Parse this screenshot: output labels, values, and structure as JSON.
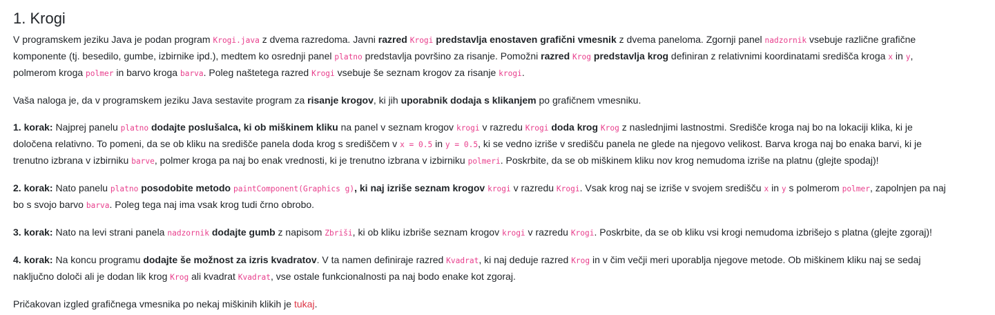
{
  "title": "1. Krogi",
  "paragraphs": [
    {
      "lines": [
        [
          {
            "t": "text",
            "v": "V programskem jeziku Java je podan program "
          },
          {
            "t": "code",
            "v": "Krogi.java"
          },
          {
            "t": "text",
            "v": " z dvema razredoma. Javni "
          },
          {
            "t": "bold",
            "v": "razred"
          },
          {
            "t": "text",
            "v": " "
          },
          {
            "t": "code",
            "v": "Krogi"
          },
          {
            "t": "text",
            "v": " "
          },
          {
            "t": "bold",
            "v": "predstavlja enostaven grafični vmesnik"
          },
          {
            "t": "text",
            "v": " z dvema paneloma. Zgornji panel "
          },
          {
            "t": "code",
            "v": "nadzornik"
          },
          {
            "t": "text",
            "v": " vsebuje različne grafične"
          }
        ],
        [
          {
            "t": "text",
            "v": "komponente (tj. besedilo, gumbe, izbirnike ipd.), medtem ko osrednji panel "
          },
          {
            "t": "code",
            "v": "platno"
          },
          {
            "t": "text",
            "v": " predstavlja površino za risanje. Pomožni "
          },
          {
            "t": "bold",
            "v": "razred"
          },
          {
            "t": "text",
            "v": " "
          },
          {
            "t": "code",
            "v": "Krog"
          },
          {
            "t": "text",
            "v": " "
          },
          {
            "t": "bold",
            "v": "predstavlja krog"
          },
          {
            "t": "text",
            "v": " definiran z relativnimi koordinatami središča kroga "
          },
          {
            "t": "code",
            "v": "x"
          },
          {
            "t": "text",
            "v": " in "
          },
          {
            "t": "code",
            "v": "y"
          },
          {
            "t": "text",
            "v": ","
          }
        ],
        [
          {
            "t": "text",
            "v": "polmerom kroga "
          },
          {
            "t": "code",
            "v": "polmer"
          },
          {
            "t": "text",
            "v": " in barvo kroga "
          },
          {
            "t": "code",
            "v": "barva"
          },
          {
            "t": "text",
            "v": ". Poleg naštetega razred "
          },
          {
            "t": "code",
            "v": "Krogi"
          },
          {
            "t": "text",
            "v": " vsebuje še seznam krogov za risanje "
          },
          {
            "t": "code",
            "v": "krogi"
          },
          {
            "t": "text",
            "v": "."
          }
        ]
      ]
    },
    {
      "lines": [
        [
          {
            "t": "text",
            "v": "Vaša naloga je, da v programskem jeziku Java sestavite program za "
          },
          {
            "t": "bold",
            "v": "risanje krogov"
          },
          {
            "t": "text",
            "v": ", ki jih "
          },
          {
            "t": "bold",
            "v": "uporabnik dodaja s klikanjem"
          },
          {
            "t": "text",
            "v": " po grafičnem vmesniku."
          }
        ]
      ]
    },
    {
      "lines": [
        [
          {
            "t": "bold",
            "v": "1. korak:"
          },
          {
            "t": "text",
            "v": " Najprej panelu "
          },
          {
            "t": "code",
            "v": "platno"
          },
          {
            "t": "text",
            "v": " "
          },
          {
            "t": "bold",
            "v": "dodajte poslušalca, ki ob miškinem kliku"
          },
          {
            "t": "text",
            "v": " na panel v seznam krogov "
          },
          {
            "t": "code",
            "v": "krogi"
          },
          {
            "t": "text",
            "v": " v razredu "
          },
          {
            "t": "code",
            "v": "Krogi"
          },
          {
            "t": "text",
            "v": " "
          },
          {
            "t": "bold",
            "v": "doda krog"
          },
          {
            "t": "text",
            "v": " "
          },
          {
            "t": "code",
            "v": "Krog"
          },
          {
            "t": "text",
            "v": " z naslednjimi lastnostmi. Središče kroga naj bo na lokaciji klika, ki je"
          }
        ],
        [
          {
            "t": "text",
            "v": "določena relativno. To pomeni, da se ob kliku na središče panela doda krog s središčem v "
          },
          {
            "t": "code",
            "v": "x = 0.5"
          },
          {
            "t": "text",
            "v": " in "
          },
          {
            "t": "code",
            "v": "y = 0.5"
          },
          {
            "t": "text",
            "v": ", ki se vedno izriše v središču panela ne glede na njegovo velikost. Barva kroga naj bo enaka barvi, ki je"
          }
        ],
        [
          {
            "t": "text",
            "v": "trenutno izbrana v izbirniku "
          },
          {
            "t": "code",
            "v": "barve"
          },
          {
            "t": "text",
            "v": ", polmer kroga pa naj bo enak vrednosti, ki je trenutno izbrana v izbirniku "
          },
          {
            "t": "code",
            "v": "polmeri"
          },
          {
            "t": "text",
            "v": ". Poskrbite, da se ob miškinem kliku nov krog nemudoma izriše na platnu (glejte spodaj)!"
          }
        ]
      ]
    },
    {
      "lines": [
        [
          {
            "t": "bold",
            "v": "2. korak:"
          },
          {
            "t": "text",
            "v": " Nato panelu "
          },
          {
            "t": "code",
            "v": "platno"
          },
          {
            "t": "text",
            "v": " "
          },
          {
            "t": "bold",
            "v": "posodobite metodo"
          },
          {
            "t": "text",
            "v": " "
          },
          {
            "t": "code",
            "v": "paintComponent(Graphics g)"
          },
          {
            "t": "bold",
            "v": ", ki naj izriše seznam krogov"
          },
          {
            "t": "text",
            "v": " "
          },
          {
            "t": "code",
            "v": "krogi"
          },
          {
            "t": "text",
            "v": " v razredu "
          },
          {
            "t": "code",
            "v": "Krogi"
          },
          {
            "t": "text",
            "v": ". Vsak krog naj se izriše v svojem središču "
          },
          {
            "t": "code",
            "v": "x"
          },
          {
            "t": "text",
            "v": " in "
          },
          {
            "t": "code",
            "v": "y"
          },
          {
            "t": "text",
            "v": " s polmerom "
          },
          {
            "t": "code",
            "v": "polmer"
          },
          {
            "t": "text",
            "v": ", zapolnjen pa naj"
          }
        ],
        [
          {
            "t": "text",
            "v": "bo s svojo barvo "
          },
          {
            "t": "code",
            "v": "barva"
          },
          {
            "t": "text",
            "v": ". Poleg tega naj ima vsak krog tudi črno obrobo."
          }
        ]
      ]
    },
    {
      "lines": [
        [
          {
            "t": "bold",
            "v": "3. korak:"
          },
          {
            "t": "text",
            "v": " Nato na levi strani panela "
          },
          {
            "t": "code",
            "v": "nadzornik"
          },
          {
            "t": "text",
            "v": " "
          },
          {
            "t": "bold",
            "v": "dodajte gumb"
          },
          {
            "t": "text",
            "v": " z napisom "
          },
          {
            "t": "code",
            "v": "Zbriši"
          },
          {
            "t": "text",
            "v": ", ki ob kliku izbriše seznam krogov "
          },
          {
            "t": "code",
            "v": "krogi"
          },
          {
            "t": "text",
            "v": " v razredu "
          },
          {
            "t": "code",
            "v": "Krogi"
          },
          {
            "t": "text",
            "v": ". Poskrbite, da se ob kliku vsi krogi nemudoma izbrišejo s platna (glejte zgoraj)!"
          }
        ]
      ]
    },
    {
      "lines": [
        [
          {
            "t": "bold",
            "v": "4. korak:"
          },
          {
            "t": "text",
            "v": " Na koncu programu "
          },
          {
            "t": "bold",
            "v": "dodajte še možnost za izris kvadratov"
          },
          {
            "t": "text",
            "v": ". V ta namen definiraje razred "
          },
          {
            "t": "code",
            "v": "Kvadrat"
          },
          {
            "t": "text",
            "v": ", ki naj deduje razred "
          },
          {
            "t": "code",
            "v": "Krog"
          },
          {
            "t": "text",
            "v": " in v čim večji meri uporablja njegove metode. Ob miškinem kliku naj se sedaj"
          }
        ],
        [
          {
            "t": "text",
            "v": "naključno določi ali je dodan lik krog "
          },
          {
            "t": "code",
            "v": "Krog"
          },
          {
            "t": "text",
            "v": " ali kvadrat "
          },
          {
            "t": "code",
            "v": "Kvadrat"
          },
          {
            "t": "text",
            "v": ", vse ostale funkcionalnosti pa naj bodo enake kot zgoraj."
          }
        ]
      ]
    },
    {
      "lines": [
        [
          {
            "t": "text",
            "v": "Pričakovan izgled grafičnega vmesnika po nekaj miškinih klikih je "
          },
          {
            "t": "link",
            "v": "tukaj"
          },
          {
            "t": "text",
            "v": "."
          }
        ]
      ]
    }
  ]
}
